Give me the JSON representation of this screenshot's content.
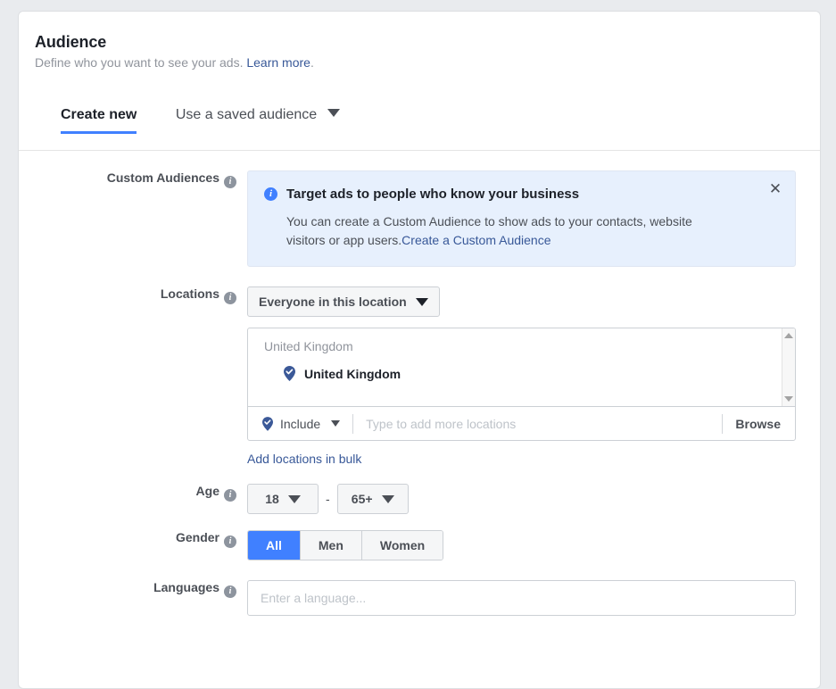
{
  "header": {
    "title": "Audience",
    "subtitle_text": "Define who you want to see your ads.",
    "subtitle_link": "Learn more",
    "subtitle_period": "."
  },
  "tabs": [
    {
      "label": "Create new",
      "active": true
    },
    {
      "label": "Use a saved audience",
      "active": false,
      "has_caret": true
    }
  ],
  "custom_audiences": {
    "label": "Custom Audiences",
    "info_glyph": "i",
    "notice": {
      "info_glyph": "i",
      "title": "Target ads to people who know your business",
      "body": "You can create a Custom Audience to show ads to your contacts, website visitors or app users.",
      "link": "Create a Custom Audience",
      "close_glyph": "✕"
    }
  },
  "locations": {
    "label": "Locations",
    "info_glyph": "i",
    "scope_dropdown": "Everyone in this location",
    "group_label": "United Kingdom",
    "items": [
      {
        "name": "United Kingdom"
      }
    ],
    "include_label": "Include",
    "typeahead_placeholder": "Type to add more locations",
    "browse_label": "Browse",
    "bulk_link": "Add locations in bulk"
  },
  "age": {
    "label": "Age",
    "info_glyph": "i",
    "min": "18",
    "dash": "-",
    "max": "65+"
  },
  "gender": {
    "label": "Gender",
    "info_glyph": "i",
    "options": [
      {
        "label": "All",
        "selected": true
      },
      {
        "label": "Men",
        "selected": false
      },
      {
        "label": "Women",
        "selected": false
      }
    ]
  },
  "languages": {
    "label": "Languages",
    "info_glyph": "i",
    "placeholder": "Enter a language...",
    "value": ""
  },
  "colors": {
    "accent_blue": "#4080ff",
    "link_blue": "#385898",
    "notice_bg": "#e7f0fd",
    "page_bg": "#e9ebee",
    "text_dark": "#1d2129",
    "text_muted": "#90949c"
  }
}
